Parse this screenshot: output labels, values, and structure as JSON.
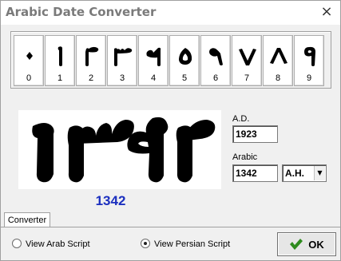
{
  "window": {
    "title": "Arabic Date Converter",
    "close_glyph": "×"
  },
  "keypad": {
    "keys": [
      {
        "label": "0",
        "glyph": "arabic-digit-0-icon"
      },
      {
        "label": "1",
        "glyph": "arabic-digit-1-icon"
      },
      {
        "label": "2",
        "glyph": "arabic-digit-2-icon"
      },
      {
        "label": "3",
        "glyph": "arabic-digit-3-icon"
      },
      {
        "label": "4",
        "glyph": "arabic-digit-4-icon"
      },
      {
        "label": "5",
        "glyph": "arabic-digit-5-icon"
      },
      {
        "label": "6",
        "glyph": "arabic-digit-6-icon"
      },
      {
        "label": "7",
        "glyph": "arabic-digit-7-icon"
      },
      {
        "label": "8",
        "glyph": "arabic-digit-8-icon"
      },
      {
        "label": "9",
        "glyph": "arabic-digit-9-icon"
      }
    ]
  },
  "display": {
    "number": "1342",
    "glyphs": [
      "arabic-digit-1-icon",
      "arabic-digit-3-icon",
      "arabic-digit-4-icon",
      "arabic-digit-2-icon"
    ]
  },
  "ad": {
    "label": "A.D.",
    "value": "1923"
  },
  "arabic": {
    "label": "Arabic",
    "value": "1342",
    "era_selected": "A.H."
  },
  "tabs": [
    {
      "label": "Converter",
      "active": true
    }
  ],
  "script_options": [
    {
      "label": "View Arab Script",
      "selected": false
    },
    {
      "label": "View Persian Script",
      "selected": true
    }
  ],
  "ok_button": {
    "label": "OK"
  },
  "colors": {
    "number_accent": "#1b2fbf",
    "ok_check": "#2e8b1e"
  }
}
